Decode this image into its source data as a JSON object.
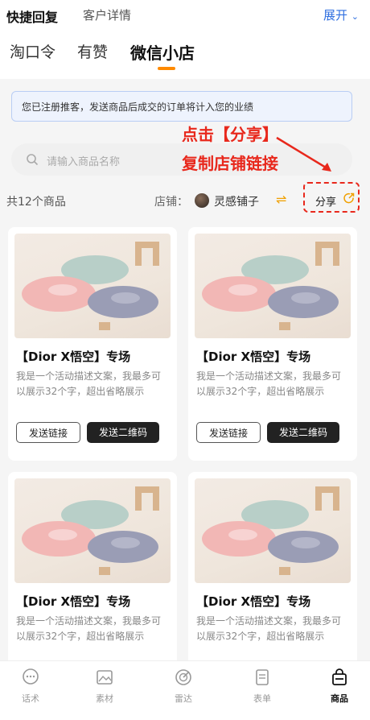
{
  "topbar": {
    "quick_reply": "快捷回复",
    "customer_detail": "客户详情",
    "expand": "展开"
  },
  "tabs": [
    "淘口令",
    "有赞",
    "微信小店"
  ],
  "notice": "您已注册推客，发送商品后成交的订单将计入您的业绩",
  "annotation": {
    "line1": "点击【分享】",
    "line2": "复制店铺链接"
  },
  "search": {
    "placeholder": "请输入商品名称"
  },
  "store": {
    "count": "共12个商品",
    "label": "店铺：",
    "name": "灵感铺子",
    "share": "分享"
  },
  "products": [
    {
      "title": "【Dior X悟空】专场",
      "desc": "我是一个活动描述文案，我最多可以展示32个字，超出省略展示",
      "send_link": "发送链接",
      "send_qr": "发送二维码"
    },
    {
      "title": "【Dior X悟空】专场",
      "desc": "我是一个活动描述文案，我最多可以展示32个字，超出省略展示",
      "send_link": "发送链接",
      "send_qr": "发送二维码"
    },
    {
      "title": "【Dior X悟空】专场",
      "desc": "我是一个活动描述文案，我最多可以展示32个字，超出省略展示"
    },
    {
      "title": "【Dior X悟空】专场",
      "desc": "我是一个活动描述文案，我最多可以展示32个字，超出省略展示"
    }
  ],
  "nav": [
    {
      "label": "话术",
      "icon": "chat-icon"
    },
    {
      "label": "素材",
      "icon": "image-icon"
    },
    {
      "label": "雷达",
      "icon": "radar-icon"
    },
    {
      "label": "表单",
      "icon": "form-icon"
    },
    {
      "label": "商品",
      "icon": "shopping-bag-icon"
    }
  ],
  "colors": {
    "accent": "#2f6fe0",
    "highlight": "#e8281c",
    "tab_indicator": "#ff8a00"
  }
}
